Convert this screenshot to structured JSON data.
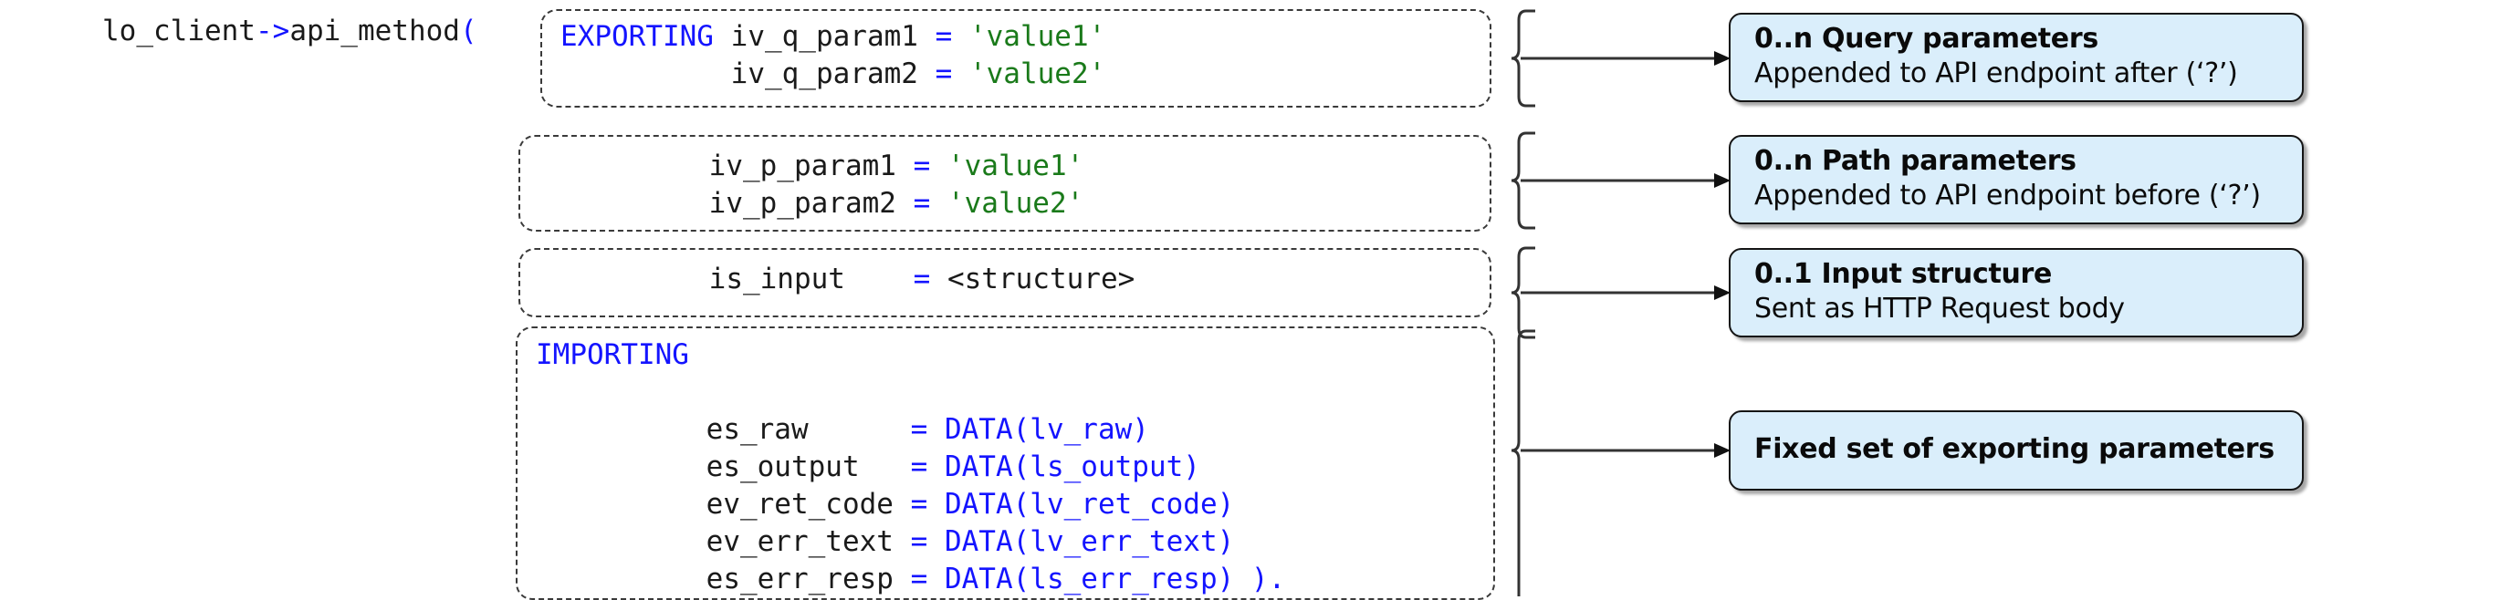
{
  "call": {
    "receiver": "lo_client",
    "arrow": "->",
    "method": "api_method",
    "open_paren": "(",
    "full": "lo_client->api_method("
  },
  "code_blocks": [
    {
      "id": "query",
      "keyword": "EXPORTING",
      "lines": [
        {
          "name": "iv_q_param1",
          "operator": "=",
          "value": "'value1'",
          "value_kind": "string"
        },
        {
          "name": "iv_q_param2",
          "operator": "=",
          "value": "'value2'",
          "value_kind": "string"
        }
      ]
    },
    {
      "id": "path",
      "keyword": "",
      "lines": [
        {
          "name": "iv_p_param1",
          "operator": "=",
          "value": "'value1'",
          "value_kind": "string"
        },
        {
          "name": "iv_p_param2",
          "operator": "=",
          "value": "'value2'",
          "value_kind": "string"
        }
      ]
    },
    {
      "id": "input",
      "keyword": "",
      "lines": [
        {
          "name": "is_input",
          "operator": "=",
          "value": "<structure>",
          "value_kind": "ident"
        }
      ]
    },
    {
      "id": "import",
      "keyword": "IMPORTING",
      "lines": [
        {
          "name": "es_raw",
          "operator": "=",
          "value": "DATA(lv_raw)",
          "value_kind": "data"
        },
        {
          "name": "es_output",
          "operator": "=",
          "value": "DATA(ls_output)",
          "value_kind": "data"
        },
        {
          "name": "ev_ret_code",
          "operator": "=",
          "value": "DATA(lv_ret_code)",
          "value_kind": "data"
        },
        {
          "name": "ev_err_text",
          "operator": "=",
          "value": "DATA(lv_err_text)",
          "value_kind": "data"
        },
        {
          "name": "es_err_resp",
          "operator": "=",
          "value": "DATA(ls_err_resp)",
          "value_kind": "data",
          "suffix": " )."
        }
      ]
    }
  ],
  "code_text": {
    "query": "EXPORTING iv_q_param1 = 'value1'\n          iv_q_param2 = 'value2'",
    "path": "          iv_p_param1 = 'value1'\n          iv_p_param2 = 'value2'",
    "input": "          is_input    = <structure>",
    "import": "IMPORTING\n          es_raw      = DATA(lv_raw)\n          es_output   = DATA(ls_output)\n          ev_ret_code = DATA(lv_ret_code)\n          ev_err_text = DATA(lv_err_text)\n          es_err_resp = DATA(ls_err_resp) )."
  },
  "callouts": [
    {
      "id": "query",
      "title": "0..n Query parameters",
      "subtitle": "Appended to API endpoint after (‘?’)"
    },
    {
      "id": "path",
      "title": "0..n Path parameters",
      "subtitle": "Appended to API endpoint before (‘?’)"
    },
    {
      "id": "input",
      "title": "0..1 Input structure",
      "subtitle": "Sent as HTTP Request body"
    },
    {
      "id": "fixed",
      "title": "Fixed set of exporting parameters",
      "subtitle": ""
    }
  ],
  "colors": {
    "keyword": "#1414ff",
    "operator": "#1414ff",
    "string": "#1a7a1a",
    "identifier": "#1a1a1a",
    "callout_fill": "#daeefb",
    "callout_border": "#141414",
    "box_border": "#3a3a3a",
    "connector": "#333333",
    "background": "#ffffff"
  }
}
